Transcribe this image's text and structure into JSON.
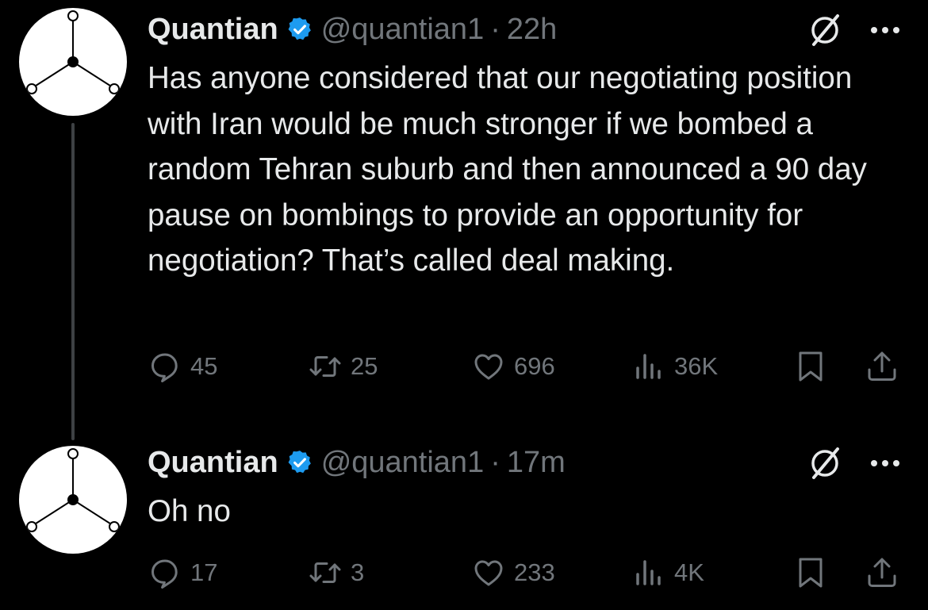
{
  "tweets": [
    {
      "name": "Quantian",
      "handle": "@quantian1",
      "dot": "·",
      "time": "22h",
      "text": "Has anyone considered that our negotiating position with Iran would be much stronger if we bombed a random Tehran suburb and then announced a 90 day pause on bombings to provide an opportunity for negotiation? That’s called deal making.",
      "replies": "45",
      "reposts": "25",
      "likes": "696",
      "views": "36K"
    },
    {
      "name": "Quantian",
      "handle": "@quantian1",
      "dot": "·",
      "time": "17m",
      "text": "Oh no",
      "replies": "17",
      "reposts": "3",
      "likes": "233",
      "views": "4K"
    }
  ],
  "icons": {
    "reply": "reply-icon",
    "repost": "repost-icon",
    "like": "heart-icon",
    "views": "views-chart-icon",
    "bookmark": "bookmark-icon",
    "share": "share-icon",
    "grok": "grok-icon",
    "more": "more-icon",
    "verified": "verified-badge-icon"
  },
  "colors": {
    "background": "#000000",
    "text": "#e7e9ea",
    "muted": "#71767b",
    "verified": "#1d9bf0"
  }
}
